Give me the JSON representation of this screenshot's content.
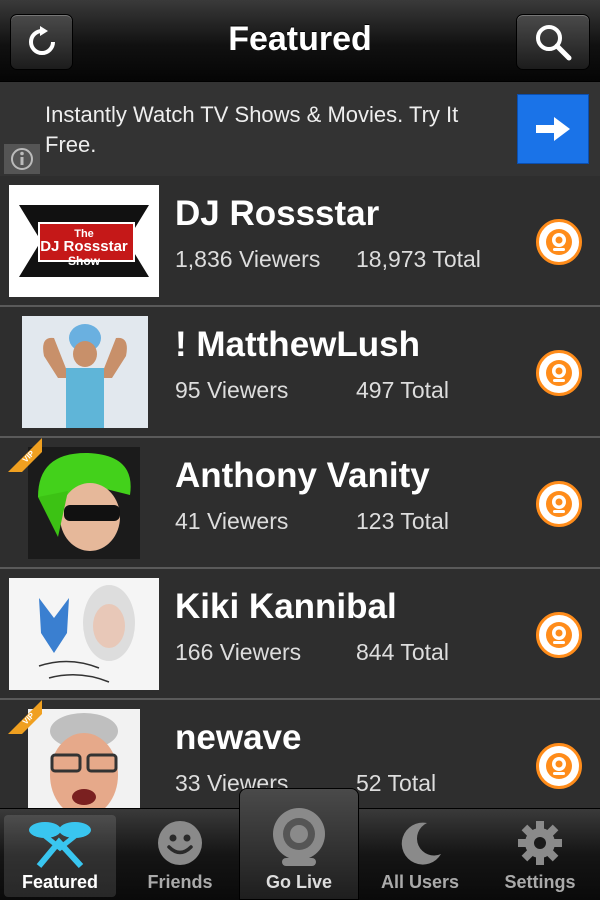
{
  "header": {
    "title": "Featured",
    "left_icon": "refresh-icon",
    "right_icon": "search-icon"
  },
  "ad": {
    "text": "Instantly Watch TV Shows & Movies. Try It Free.",
    "info_icon": "info-icon",
    "arrow_icon": "arrow-right-icon",
    "accent": "#1a73e8"
  },
  "list": {
    "items": [
      {
        "name": "DJ Rossstar",
        "viewers": "1,836 Viewers",
        "total": "18,973 Total",
        "vip": false,
        "thumb_text": "The DJ Rossstar Show"
      },
      {
        "name": "! MatthewLush",
        "viewers": "95 Viewers",
        "total": "497 Total",
        "vip": false
      },
      {
        "name": "Anthony Vanity",
        "viewers": "41 Viewers",
        "total": "123 Total",
        "vip": true
      },
      {
        "name": "Kiki Kannibal",
        "viewers": "166 Viewers",
        "total": "844 Total",
        "vip": false
      },
      {
        "name": "newave",
        "viewers": "33 Viewers",
        "total": "52 Total",
        "vip": true
      }
    ],
    "vip_label": "VIP",
    "cam_color": "#ff8c1a"
  },
  "tabs": {
    "featured": "Featured",
    "friends": "Friends",
    "go_live": "Go Live",
    "all_users": "All Users",
    "settings": "Settings"
  }
}
